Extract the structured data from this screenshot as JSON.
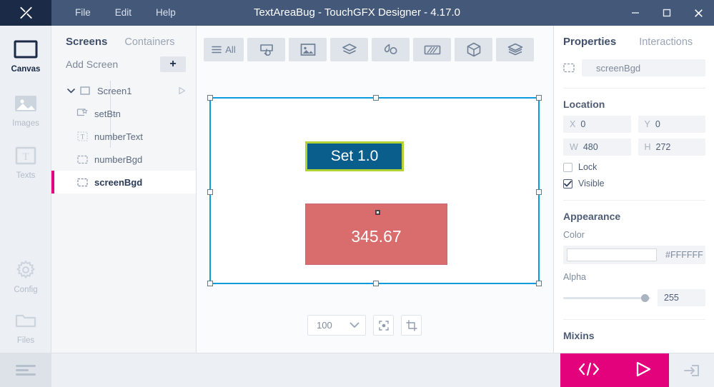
{
  "titlebar": {
    "logo": "X",
    "title": "TextAreaBug - TouchGFX Designer - 4.17.0",
    "menu": [
      {
        "label": "File",
        "name": "menu-file"
      },
      {
        "label": "Edit",
        "name": "menu-edit"
      },
      {
        "label": "Help",
        "name": "menu-help"
      }
    ],
    "controls": {
      "minimize": "minimize-icon",
      "maximize": "maximize-icon",
      "close": "close-icon"
    },
    "colors": {
      "bg": "#44597a",
      "logo_bg": "#1b2a47",
      "accent": "#29a8df"
    }
  },
  "rail": {
    "items": [
      {
        "label": "Canvas",
        "icon": "canvas-icon",
        "active": true
      },
      {
        "label": "Images",
        "icon": "images-icon",
        "active": false
      },
      {
        "label": "Texts",
        "icon": "texts-icon",
        "active": false
      },
      {
        "label": "Config",
        "icon": "config-icon",
        "active": false
      },
      {
        "label": "Files",
        "icon": "files-icon",
        "active": false
      }
    ],
    "bottom_icon": "menu-hamburger-icon"
  },
  "screens_panel": {
    "tabs": [
      {
        "label": "Screens",
        "active": true
      },
      {
        "label": "Containers",
        "active": false
      }
    ],
    "add_screen_label": "Add Screen",
    "add_button_label": "+",
    "tree": {
      "root": {
        "label": "Screen1",
        "icon": "screen-box-icon",
        "caret": "chevron-down-icon",
        "play": "play-icon"
      },
      "children": [
        {
          "label": "setBtn",
          "icon": "button-widget-icon",
          "selected": false
        },
        {
          "label": "numberText",
          "icon": "text-widget-icon",
          "selected": false
        },
        {
          "label": "numberBgd",
          "icon": "box-widget-icon",
          "selected": false
        },
        {
          "label": "screenBgd",
          "icon": "box-widget-icon",
          "selected": true
        }
      ]
    }
  },
  "canvas": {
    "toolbar": [
      {
        "label": "All",
        "icon": "list-all-icon"
      },
      {
        "label": "",
        "icon": "button-widget-icon"
      },
      {
        "label": "",
        "icon": "image-widget-icon"
      },
      {
        "label": "",
        "icon": "shape-layers-icon"
      },
      {
        "label": "",
        "icon": "canvas-shape-icon"
      },
      {
        "label": "",
        "icon": "texture-mapper-icon"
      },
      {
        "label": "",
        "icon": "cube-3d-icon"
      },
      {
        "label": "",
        "icon": "container-stack-icon"
      }
    ],
    "artboard": {
      "selection_color": "#0a9ade",
      "widgets": [
        {
          "name": "setBtn",
          "type": "button",
          "label": "Set 1.0",
          "fill": "#0a5e8c",
          "border": "#b3d334",
          "text_color": "#ffffff"
        },
        {
          "name": "numberBgd",
          "type": "box",
          "label": "345.67",
          "fill": "#d96c6c",
          "text_color": "#ffffff"
        }
      ]
    },
    "bottom_controls": {
      "zoom_value": "100",
      "zoom_caret": "chevron-down-icon",
      "fit_icon": "fit-to-screen-icon",
      "crop_icon": "crop-icon"
    }
  },
  "properties": {
    "tabs": [
      {
        "label": "Properties",
        "active": true
      },
      {
        "label": "Interactions",
        "active": false
      }
    ],
    "widget_icon": "box-widget-icon",
    "widget_name": "screenBgd",
    "location": {
      "heading": "Location",
      "fields": [
        {
          "key": "X",
          "value": "0"
        },
        {
          "key": "Y",
          "value": "0"
        },
        {
          "key": "W",
          "value": "480"
        },
        {
          "key": "H",
          "value": "272"
        }
      ],
      "lock": {
        "label": "Lock",
        "checked": false
      },
      "visible": {
        "label": "Visible",
        "checked": true
      }
    },
    "appearance": {
      "heading": "Appearance",
      "color_label": "Color",
      "color_hex": "#FFFFFF",
      "color_swatch": "#FFFFFF",
      "alpha_label": "Alpha",
      "alpha_value": "255",
      "alpha_percent": 100
    },
    "mixins_heading": "Mixins"
  },
  "bottombar": {
    "run_bg": "#e4017c",
    "code_icon": "code-brackets-icon",
    "run_icon": "run-play-icon",
    "export_icon": "export-arrow-icon"
  }
}
